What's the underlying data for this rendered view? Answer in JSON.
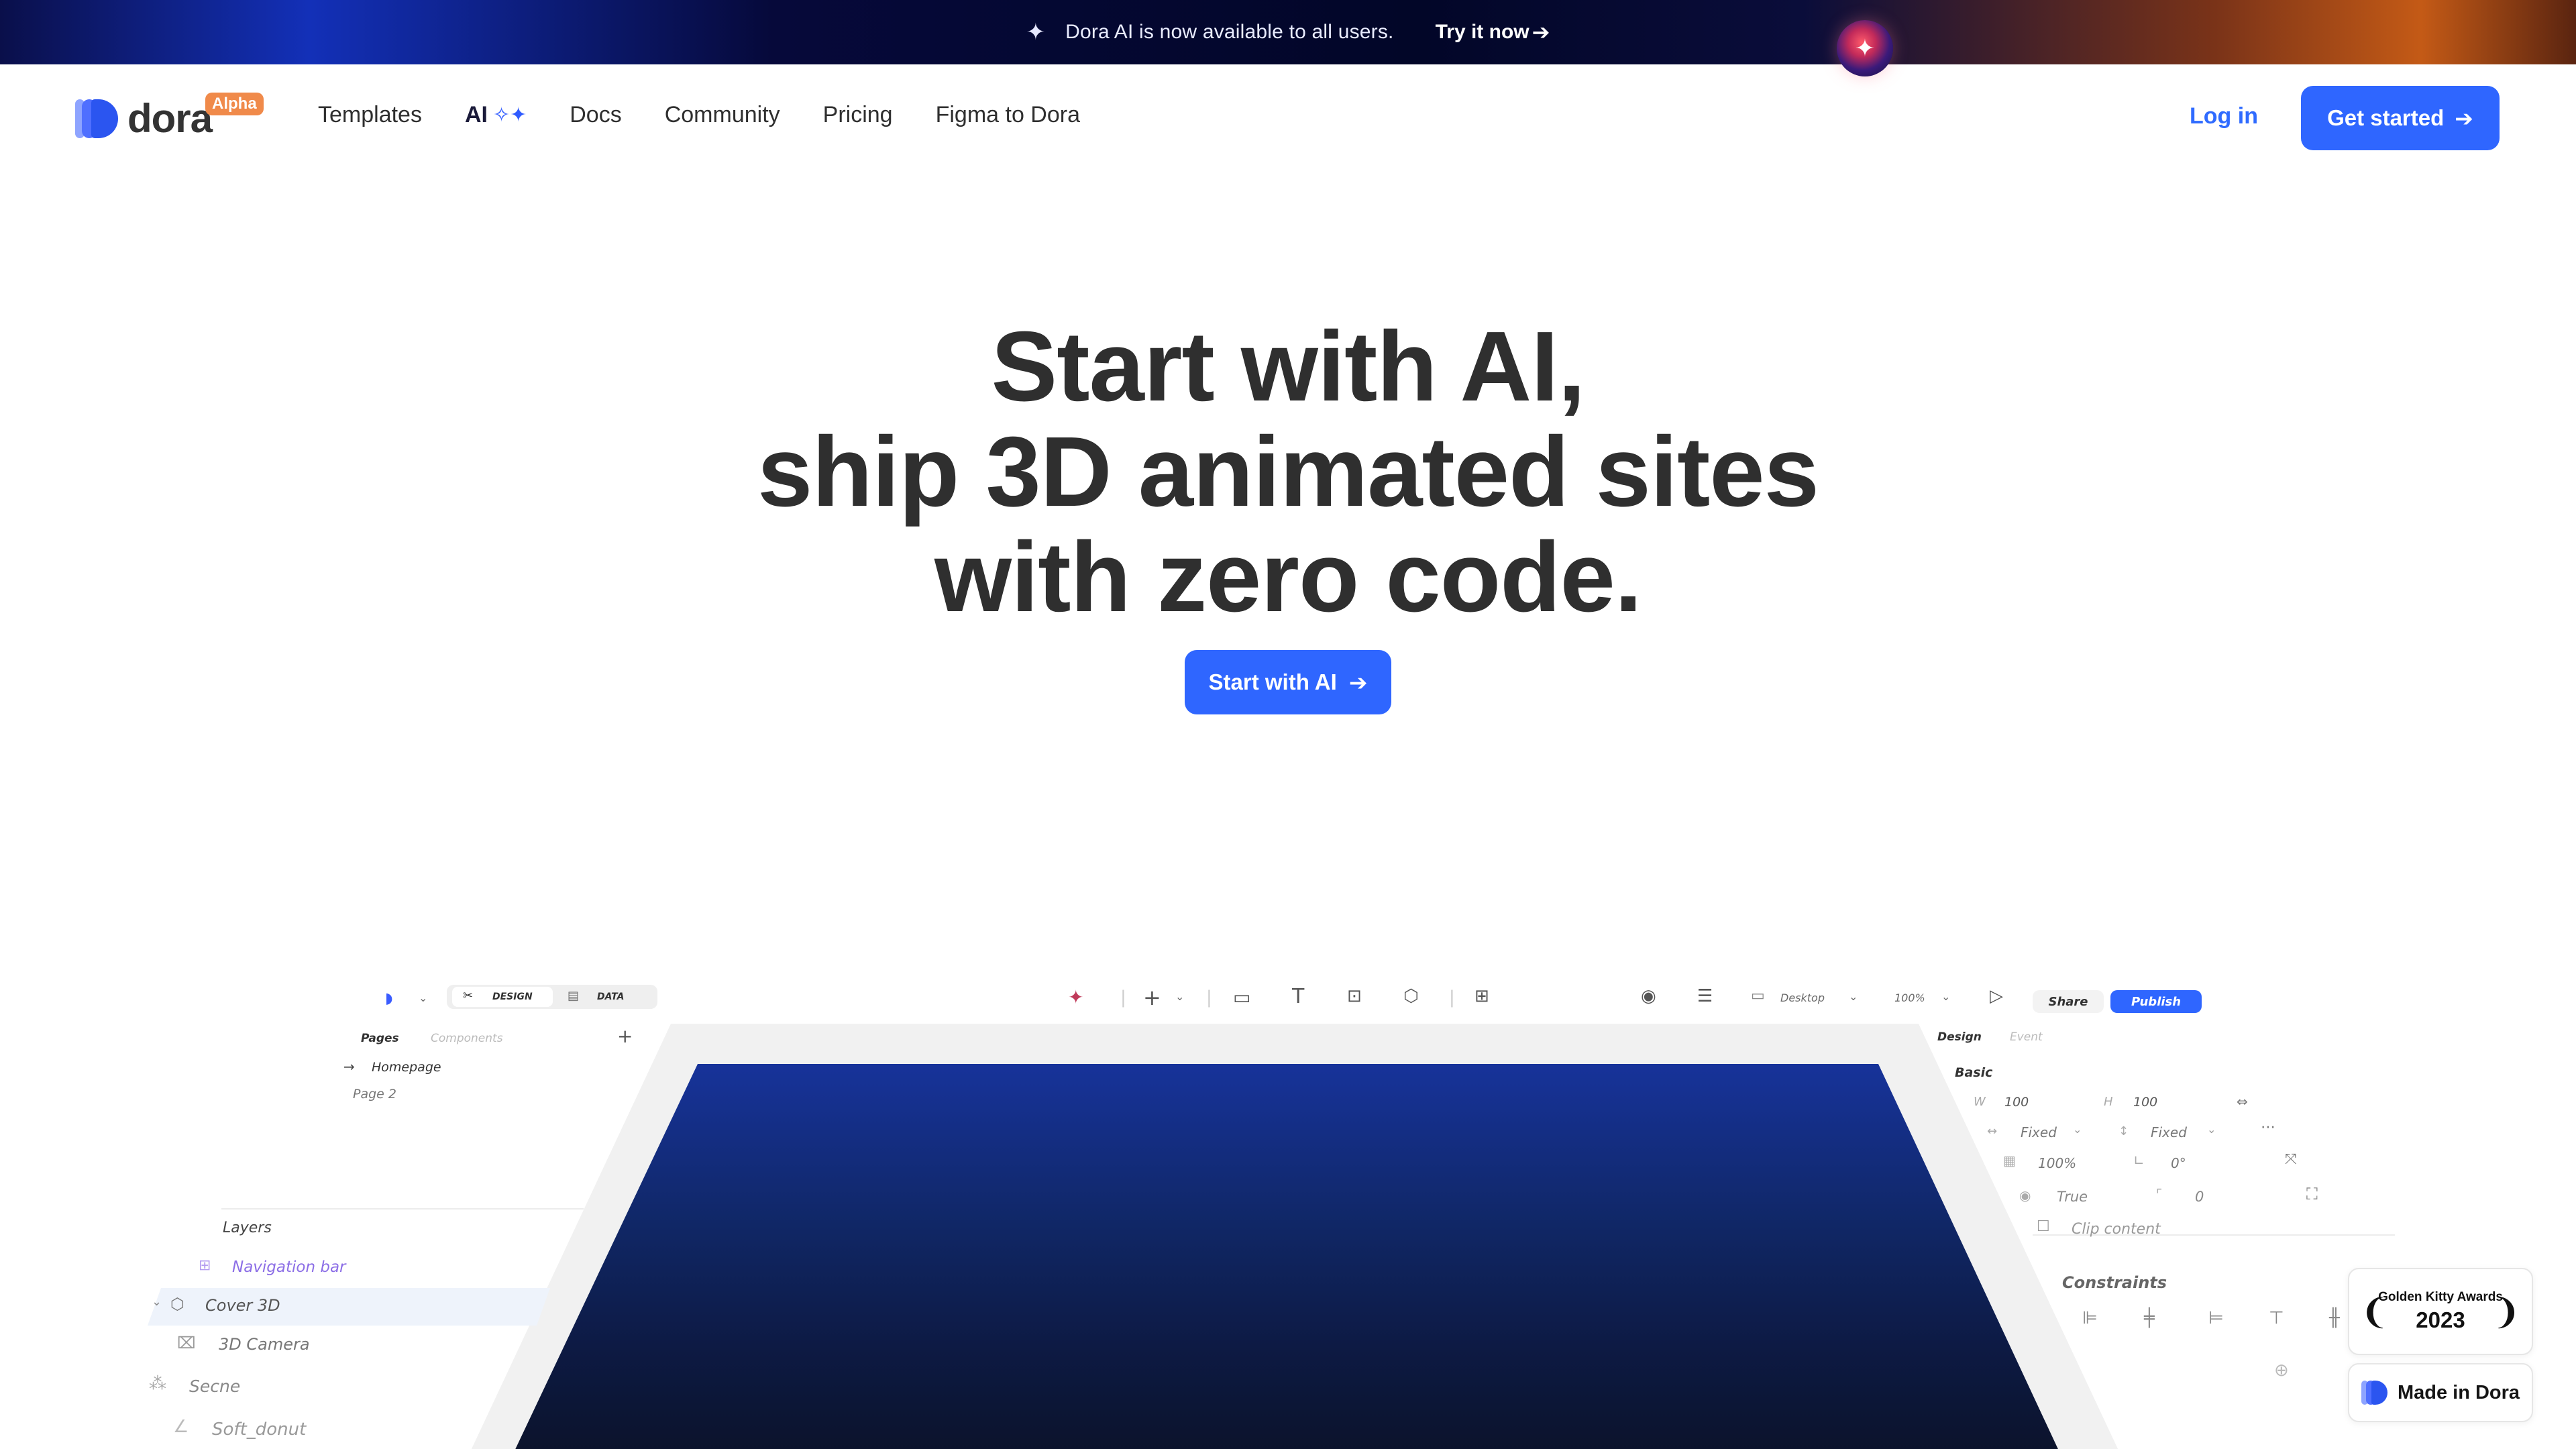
{
  "announcement": {
    "message": "Dora AI is now available to all users.",
    "cta": "Try it now",
    "spark_icon": "sparkle-icon"
  },
  "nav": {
    "logo_text": "dora",
    "badge": "Alpha",
    "items": [
      "Templates",
      "AI",
      "Docs",
      "Community",
      "Pricing",
      "Figma to Dora"
    ],
    "login": "Log in",
    "get_started": "Get started"
  },
  "hero": {
    "line1": "Start with AI,",
    "line2": "ship 3D animated sites",
    "line3": "with zero code.",
    "cta": "Start with AI"
  },
  "editor": {
    "tabs": [
      "DESIGN",
      "DATA"
    ],
    "device": "Desktop",
    "zoom": "100%",
    "share": "Share",
    "publish": "Publish",
    "left": {
      "tabs": [
        "Pages",
        "Components"
      ],
      "pages": [
        "Homepage",
        "Page 2"
      ],
      "layers_title": "Layers",
      "layers": [
        "Navigation bar",
        "Cover 3D",
        "3D Camera",
        "Secne",
        "Soft_donut"
      ]
    },
    "right": {
      "tabs": [
        "Design",
        "Event"
      ],
      "section": "Basic",
      "w_label": "W",
      "w": "100",
      "h_label": "H",
      "h": "100",
      "width_mode": "Fixed",
      "height_mode": "Fixed",
      "opacity": "100%",
      "rotation": "0°",
      "visible": "True",
      "radius": "0",
      "clip": "Clip content",
      "constraints": "Constraints"
    }
  },
  "badges": {
    "award_title": "Golden Kitty Awards",
    "award_year": "2023",
    "made_in": "Made in Dora"
  },
  "colors": {
    "accent": "#2f66ff",
    "badge": "#f08a4a",
    "text": "#2f2f2f"
  }
}
